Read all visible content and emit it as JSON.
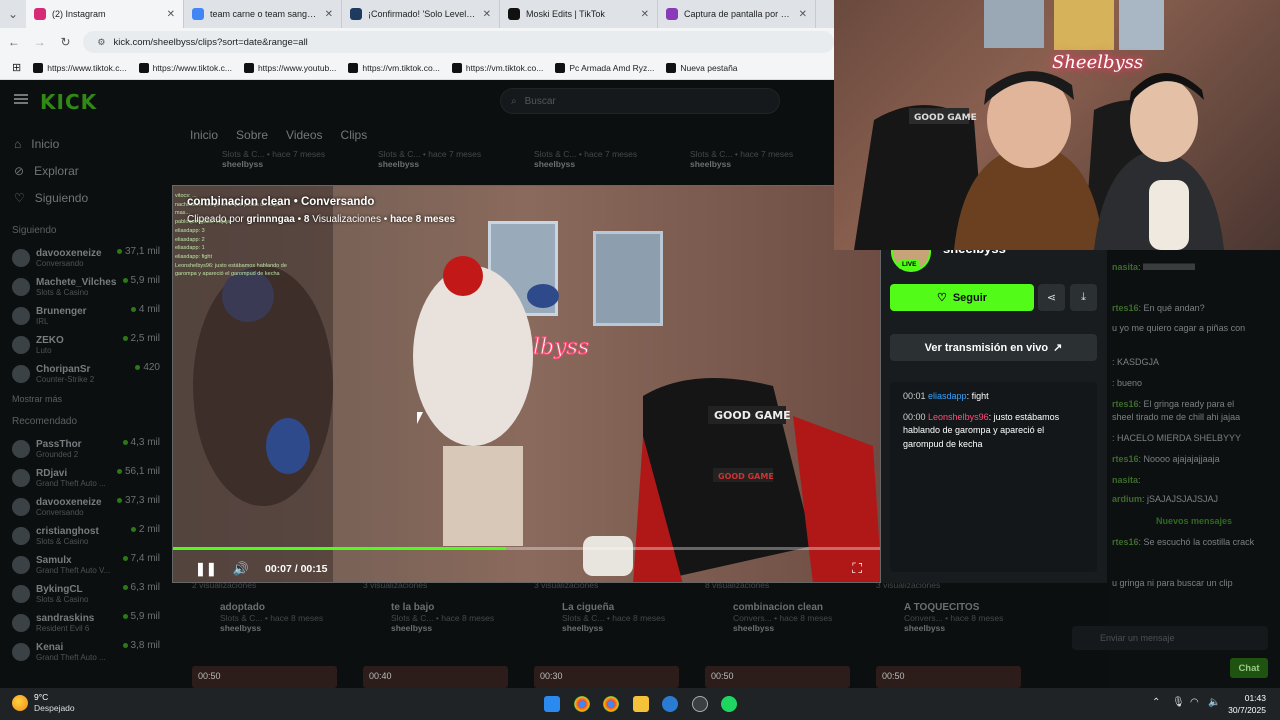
{
  "browser": {
    "tabs": [
      {
        "title": "(2) Instagram",
        "color": "#d62976",
        "active": true
      },
      {
        "title": "team carne o team sangre - Bu",
        "color": "#4285f4",
        "active": false
      },
      {
        "title": "¡Confirmado! 'Solo Leveling' Te",
        "color": "#1e3a5f",
        "active": false
      },
      {
        "title": "Moski Edits | TikTok",
        "color": "#111111",
        "active": false
      },
      {
        "title": "Captura de pantalla por Lightsh",
        "color": "#8a3ab9",
        "active": false
      }
    ],
    "url": "kick.com/sheelbyss/clips?sort=date&range=all",
    "bookmarks": [
      "https://www.tiktok.c...",
      "https://www.tiktok.c...",
      "https://www.youtub...",
      "https://vm.tiktok.co...",
      "https://vm.tiktok.co...",
      "Pc Armada Amd Ryz...",
      "Nueva pestaña"
    ]
  },
  "kick": {
    "logo": "KICK",
    "search_placeholder": "Buscar",
    "nav": [
      "Inicio",
      "Explorar",
      "Siguiendo"
    ],
    "following_header": "Siguiendo",
    "following": [
      {
        "name": "davooxeneize",
        "category": "Conversando",
        "viewers": "37,1 mil"
      },
      {
        "name": "Machete_Vilches",
        "category": "Slots & Casino",
        "viewers": "5,9 mil"
      },
      {
        "name": "Brunenger",
        "category": "IRL",
        "viewers": "4 mil"
      },
      {
        "name": "ZEKO",
        "category": "Luto",
        "viewers": "2,5 mil"
      },
      {
        "name": "ChoripanSr",
        "category": "Counter-Strike 2",
        "viewers": "420"
      }
    ],
    "show_more": "Mostrar más",
    "recommended_header": "Recomendado",
    "recommended": [
      {
        "name": "PassThor",
        "category": "Grounded 2",
        "viewers": "4,3 mil"
      },
      {
        "name": "RDjavi",
        "category": "Grand Theft Auto ...",
        "viewers": "56,1 mil"
      },
      {
        "name": "davooxeneize",
        "category": "Conversando",
        "viewers": "37,3 mil"
      },
      {
        "name": "cristianghost",
        "category": "Slots & Casino",
        "viewers": "2 mil"
      },
      {
        "name": "Samulx",
        "category": "Grand Theft Auto V...",
        "viewers": "7,4 mil"
      },
      {
        "name": "BykingCL",
        "category": "Slots & Casino",
        "viewers": "6,3 mil"
      },
      {
        "name": "sandraskins",
        "category": "Resident Evil 6",
        "viewers": "5,9 mil"
      },
      {
        "name": "Kenai",
        "category": "Grand Theft Auto ...",
        "viewers": "3,8 mil"
      }
    ],
    "profile_tabs": [
      "Inicio",
      "Sobre",
      "Videos",
      "Clips"
    ],
    "top_clips": [
      {
        "meta": "Slots & C... • hace 7 meses",
        "user": "sheelbyss"
      },
      {
        "meta": "Slots & C... • hace 7 meses",
        "user": "sheelbyss"
      },
      {
        "meta": "Slots & C... • hace 7 meses",
        "user": "sheelbyss"
      },
      {
        "meta": "Slots & C... • hace 7 meses",
        "user": "sheelbyss"
      }
    ],
    "bottom_clips": [
      {
        "views": "2 visualizaciones",
        "title": "adoptado",
        "meta": "Slots & C... • hace 8 meses",
        "user": "sheelbyss"
      },
      {
        "views": "3 visualizaciones",
        "title": "te la bajo",
        "meta": "Slots & C... • hace 8 meses",
        "user": "sheelbyss"
      },
      {
        "views": "3 visualizaciones",
        "title": "La cigueña",
        "meta": "Slots & C... • hace 8 meses",
        "user": "sheelbyss"
      },
      {
        "views": "8 visualizaciones",
        "title": "combinacion clean",
        "meta": "Convers... • hace 8 meses",
        "user": "sheelbyss"
      },
      {
        "views": "3 visualizaciones",
        "title": "A TOQUECITOS",
        "meta": "Convers... • hace 8 meses",
        "user": "sheelbyss"
      }
    ],
    "thumb_durations": [
      "00:50",
      "00:40",
      "00:30",
      "00:50",
      "00:50"
    ]
  },
  "player": {
    "title": "combinacion clean",
    "category": "Conversando",
    "clipped_by_label": "Clipeado por",
    "clipped_by": "grinnngaa",
    "views_number": "8",
    "views_label": "Visualizaciones",
    "ago": "hace 8 meses",
    "time": "00:07 / 00:15",
    "progress": 0.47,
    "mini_chat": [
      "vitocs: ...",
      "nachosiem: amigo creo que pesas un toque",
      "mas...",
      "pabloquiroga83: Jajaja",
      "eliasdapp: 3",
      "eliasdapp: 2",
      "eliasdapp: 1",
      "eliasdapp: fight",
      "Leonshelbys96: justo estábamos hablando de garompa y apareció el garompud de kecha"
    ]
  },
  "panel": {
    "channel": "sheelbyss",
    "live_badge": "LIVE",
    "follow_label": "Seguir",
    "watch_live_label": "Ver transmisión en vivo",
    "messages": [
      {
        "time": "00:01",
        "user": "eliasdapp",
        "text": ": fight"
      },
      {
        "time": "00:00",
        "user": "Leonshelbys96",
        "text": ": justo estábamos hablando de garompa y apareció el garompud de kecha"
      }
    ]
  },
  "chat": {
    "lines": [
      {
        "user": "nasita",
        "text": ": llllllllllllllllllllllllll"
      },
      {
        "user": "rtes16",
        "text": ": En qué andan?"
      },
      {
        "user": "",
        "text": "u yo me quiero cagar a piñas con"
      },
      {
        "user": "",
        "text": ": KASDGJA"
      },
      {
        "user": "",
        "text": ": bueno"
      },
      {
        "user": "rtes16",
        "text": ": El gringa ready para el"
      },
      {
        "user": "",
        "text": "sheel tirado me de chill ahi jajaa"
      },
      {
        "user": "",
        "text": ": HACELO MIERDA SHELBYYY"
      },
      {
        "user": "rtes16",
        "text": ": Noooo ajajajajjaaja"
      },
      {
        "user": "nasita",
        "text": ":"
      },
      {
        "user": "ardium",
        "text": ": jSAJAJSJAJSJAJ"
      }
    ],
    "new_messages": "Nuevos mensajes",
    "after_lines": [
      {
        "user": "rtes16",
        "text": ": Se escuchó la costilla crack"
      },
      {
        "user": "",
        "text": "u gringa ni para buscar un clip"
      }
    ],
    "input_placeholder": "Enviar un mensaje",
    "send_label": "Chat"
  },
  "webcam": {
    "sign": "Sheelbyss"
  },
  "taskbar": {
    "temp": "9°C",
    "weather": "Despejado",
    "time": "01:43",
    "date": "30/7/2025"
  },
  "colors": {
    "kick_green": "#53fc18",
    "panel_bg": "#191c1e",
    "page_bg": "#0c0f10"
  }
}
